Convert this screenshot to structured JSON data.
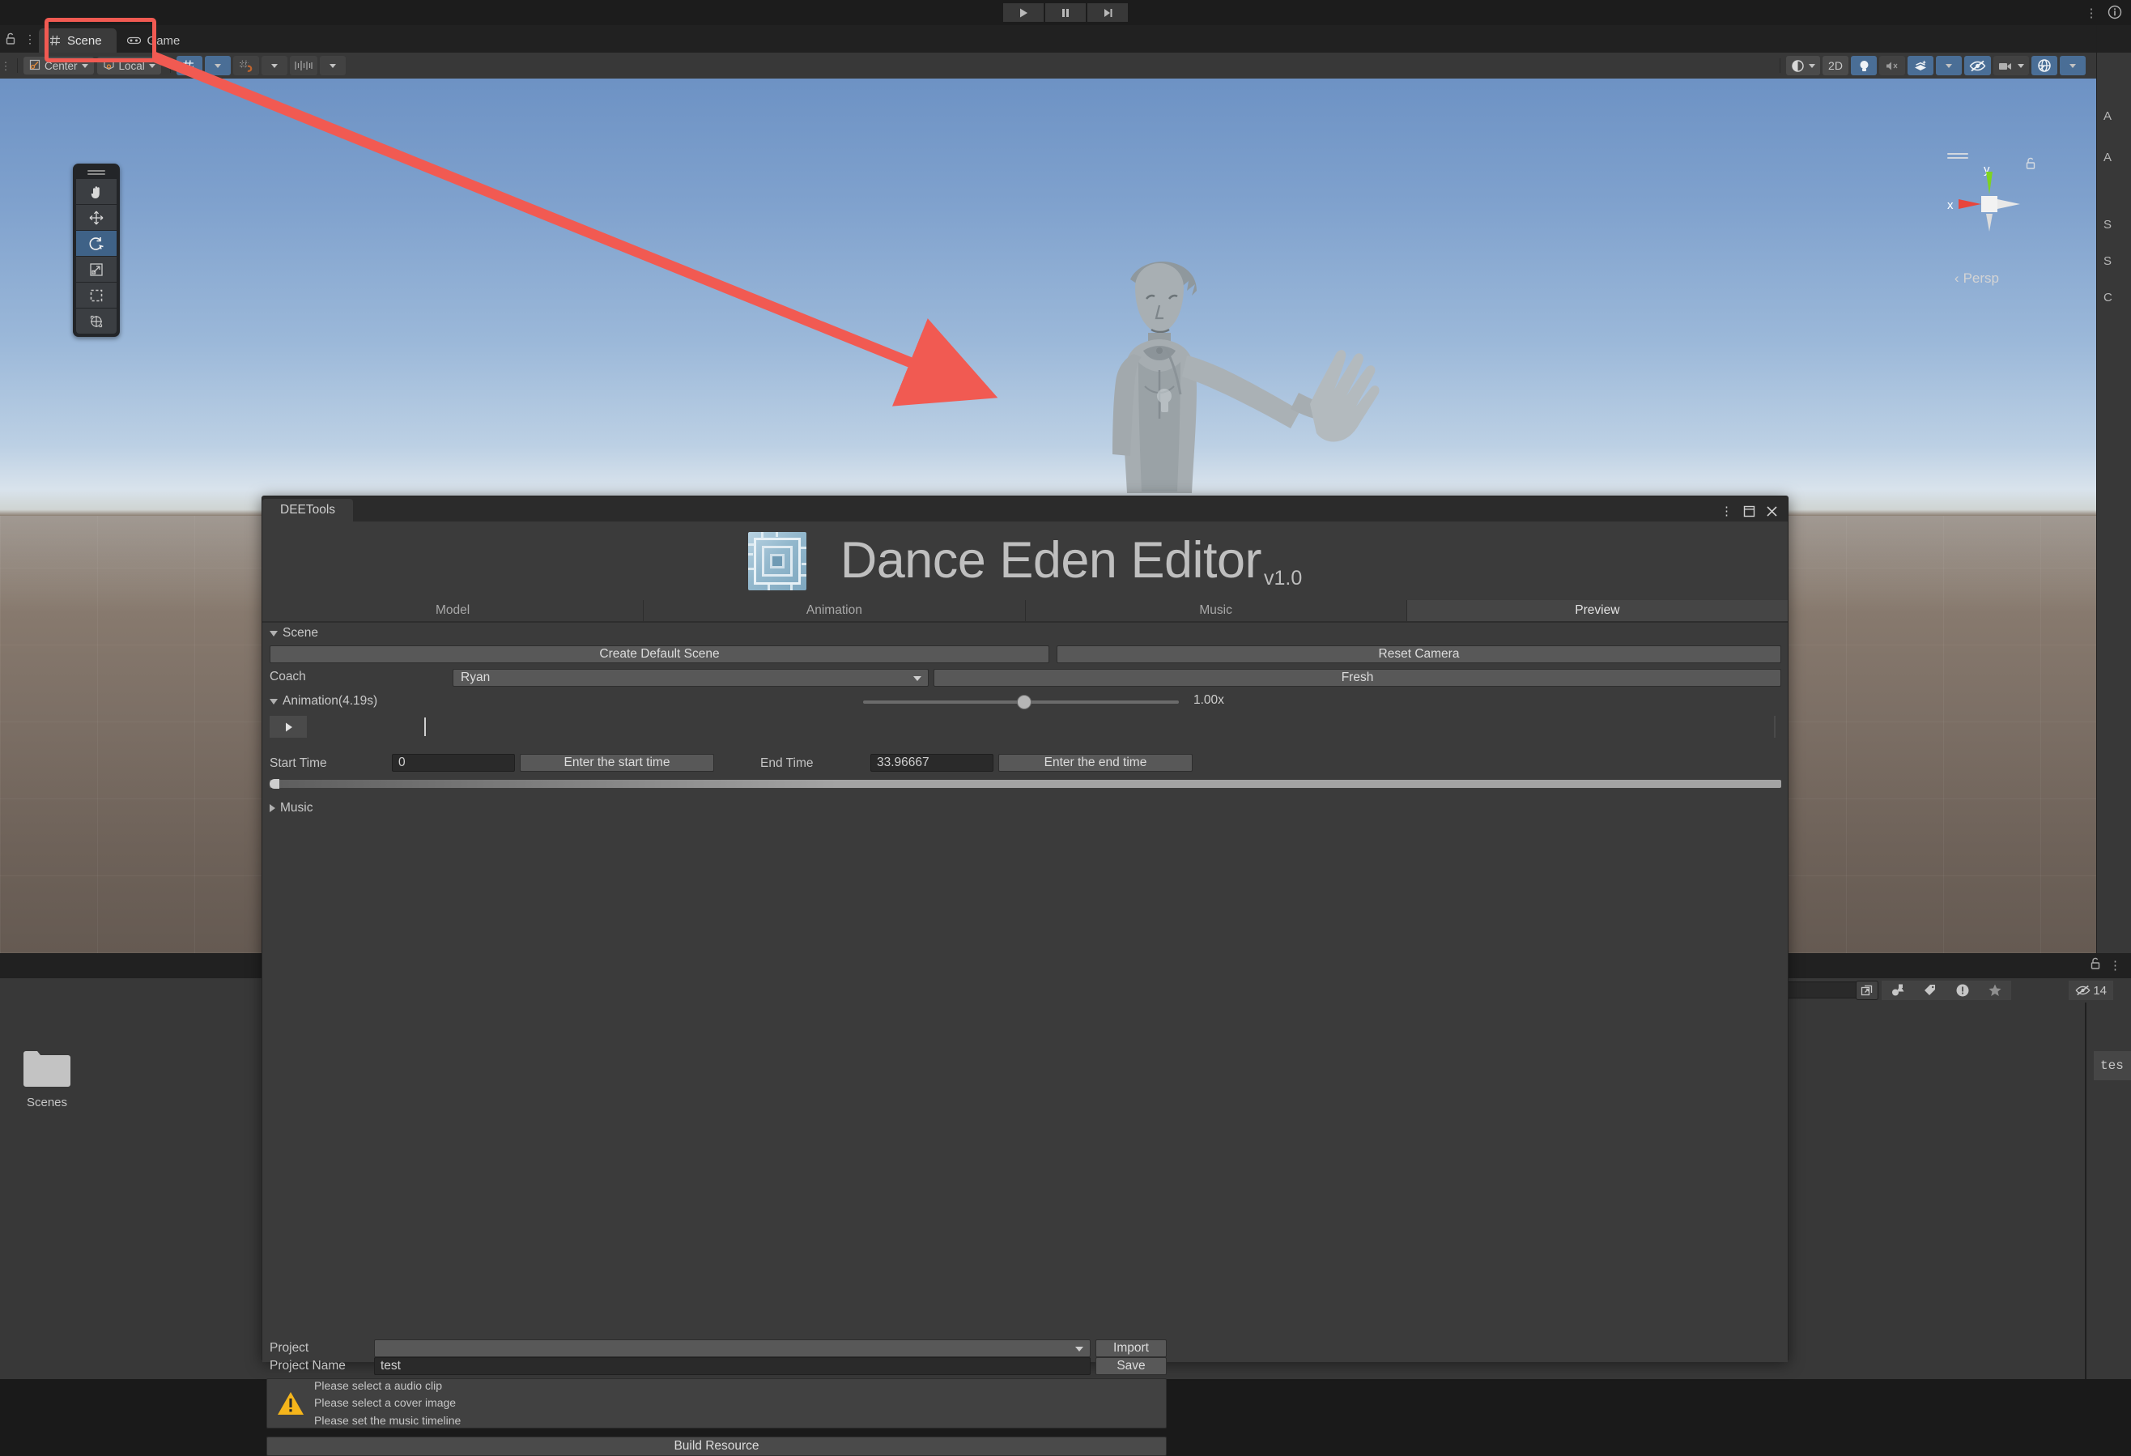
{
  "app": {
    "transport": {
      "play": "play-icon",
      "pause": "pause-icon",
      "step": "step-icon"
    }
  },
  "scene_panel": {
    "tabs": [
      {
        "label": "Scene",
        "icon": "grid-icon",
        "active": true
      },
      {
        "label": "Game",
        "icon": "gamepad-icon",
        "active": false
      }
    ],
    "toolbar": {
      "pivot_mode": "Center",
      "pivot_rotation": "Local",
      "grid_snap_icon": "grid-axis-icon",
      "magnet_icon": "magnet-snap-icon",
      "increment_icon": "increment-snap-icon",
      "draw_mode": "Shaded",
      "two_d_label": "2D",
      "lighting_icon": "light-bulb-icon",
      "audio_icon": "audio-mute-icon",
      "fx_icon": "effects-icon",
      "hidden_icon": "hidden-objects-icon",
      "camera_icon": "scene-camera-icon",
      "gizmos_icon": "gizmos-icon"
    },
    "gizmo": {
      "x_label": "x",
      "y_label": "y",
      "perspective_label": "Persp"
    },
    "tools": [
      {
        "name": "hand-tool",
        "active": false
      },
      {
        "name": "move-tool",
        "active": false
      },
      {
        "name": "rotate-tool",
        "active": true
      },
      {
        "name": "scale-tool",
        "active": false
      },
      {
        "name": "rect-tool",
        "active": false
      },
      {
        "name": "transform-tool",
        "active": false
      }
    ]
  },
  "project_panel": {
    "search_placeholder": "",
    "filter_icons": [
      "type-filter-icon",
      "label-filter-icon",
      "warning-filter-icon",
      "favorite-filter-icon"
    ],
    "hidden_count": "14",
    "folder": {
      "label": "Scenes",
      "icon": "folder-icon"
    },
    "right_preview_text": "tes"
  },
  "deetools": {
    "window_tab": "DEETools",
    "title": "Dance Eden Editor",
    "version": "v1.0",
    "logo_icon": "circuit-chip-icon",
    "tabs": [
      {
        "label": "Model",
        "active": false
      },
      {
        "label": "Animation",
        "active": false
      },
      {
        "label": "Music",
        "active": false
      },
      {
        "label": "Preview",
        "active": true
      }
    ],
    "scene_section": {
      "foldout_label": "Scene",
      "create_default_scene": "Create Default Scene",
      "reset_camera": "Reset Camera",
      "coach_label": "Coach",
      "coach_value": "Ryan",
      "fresh_button": "Fresh"
    },
    "animation_section": {
      "foldout_label": "Animation(4.19s)",
      "speed_value": "1.00x",
      "play_icon": "play-icon",
      "start_time_label": "Start Time",
      "start_time_value": "0",
      "start_time_button": "Enter the start time",
      "end_time_label": "End Time",
      "end_time_value": "33.96667",
      "end_time_button": "Enter the end time"
    },
    "music_section": {
      "foldout_label": "Music"
    },
    "footer": {
      "project_label": "Project",
      "project_value": "",
      "import_button": "Import",
      "project_name_label": "Project Name",
      "project_name_value": "test",
      "save_button": "Save",
      "warnings": [
        "Please select a audio clip",
        "Please select a cover image",
        "Please set the music timeline"
      ],
      "warning_icon": "warning-triangle-icon",
      "build_button": "Build Resource"
    }
  },
  "annotation": {
    "highlight_color": "#f15a52",
    "target": "scene-tab"
  },
  "right_edge_labels": [
    "A",
    "A",
    "S",
    "S",
    "C"
  ]
}
